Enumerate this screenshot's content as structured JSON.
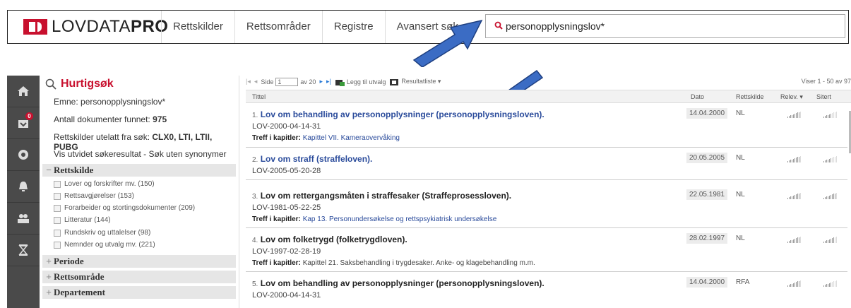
{
  "header": {
    "logo_text_light": "LOVDATA",
    "logo_text_bold": "PRO",
    "nav": [
      "Rettskilder",
      "Rettsområder",
      "Registre",
      "Avansert søk"
    ],
    "search_value": "personopplysningslov*"
  },
  "rail": {
    "icons": [
      "home-icon",
      "inbox-icon",
      "settings-icon",
      "bell-icon",
      "users-icon",
      "hourglass-icon"
    ],
    "badge": "0"
  },
  "panel": {
    "title": "Hurtigsøk",
    "emne_label": "Emne:",
    "emne_value": "personopplysningslov*",
    "antall_label": "Antall dokumenter funnet:",
    "antall_value": "975",
    "utelatt_label": "Rettskilder utelatt fra søk:",
    "utelatt_value": "CLX0, LTI, LTII, PUBG",
    "utvidet": "Vis utvidet søkeresultat - Søk uten synonymer",
    "sections": [
      {
        "sign": "−",
        "label": "Rettskilde"
      },
      {
        "sign": "+",
        "label": "Periode"
      },
      {
        "sign": "+",
        "label": "Rettsområde"
      },
      {
        "sign": "+",
        "label": "Departement"
      }
    ],
    "filters": [
      "Lover og forskrifter mv. (150)",
      "Rettsavgjørelser (153)",
      "Forarbeider og stortingsdokumenter (209)",
      "Litteratur (144)",
      "Rundskriv og uttalelser (98)",
      "Nemnder og utvalg mv. (221)"
    ]
  },
  "toolbar": {
    "side_label": "Side",
    "page_value": "1",
    "av_label": "av 20",
    "legg_til": "Legg til utvalg",
    "resultatliste": "Resultatliste ▾",
    "viser": "Viser 1 - 50 av 97"
  },
  "columns": {
    "tittel": "Tittel",
    "dato": "Dato",
    "rettskilde": "Rettskilde",
    "relev": "Relev. ▾",
    "sitert": "Sitert"
  },
  "results": [
    {
      "num": "1.",
      "title": "Lov om behandling av personopplysninger (personopplysningsloven).",
      "code": "LOV-2000-04-14-31",
      "treff_label": "Treff i kapitler:",
      "treff": "Kapittel VII. Kameraovervåking",
      "date": "14.04.2000",
      "source": "NL",
      "relevance": 0.9,
      "cited": 0.6
    },
    {
      "num": "2.",
      "title": "Lov om straff (straffeloven).",
      "code": "LOV-2005-05-20-28",
      "treff_label": "",
      "treff": "",
      "date": "20.05.2005",
      "source": "NL",
      "relevance": 0.9,
      "cited": 0.6
    },
    {
      "num": "3.",
      "title": "Lov om rettergangsmåten i straffesaker (Straffeprosessloven).",
      "code": "LOV-1981-05-22-25",
      "treff_label": "Treff i kapitler:",
      "treff": "Kap 13. Personundersøkelse og rettspsykiatrisk undersøkelse",
      "date": "22.05.1981",
      "source": "NL",
      "relevance": 0.9,
      "cited": 0.9
    },
    {
      "num": "4.",
      "title": "Lov om folketrygd (folketrygdloven).",
      "code": "LOV-1997-02-28-19",
      "treff_label": "Treff i kapitler:",
      "treff": "Kapittel 21. Saksbehandling i trygdesaker. Anke- og klagebehandling m.m.",
      "date": "28.02.1997",
      "source": "NL",
      "relevance": 0.9,
      "cited": 0.8
    },
    {
      "num": "5.",
      "title": "Lov om behandling av personopplysninger (personopplysningsloven).",
      "code": "LOV-2000-04-14-31",
      "treff_label": "",
      "treff": "",
      "date": "14.04.2000",
      "source": "RFA",
      "relevance": 0.9,
      "cited": 0.6
    }
  ],
  "colors": {
    "brand": "#c8102e",
    "link": "#2a4b9b",
    "arrow": "#3b6cc4",
    "rail": "#4a4a4a"
  }
}
